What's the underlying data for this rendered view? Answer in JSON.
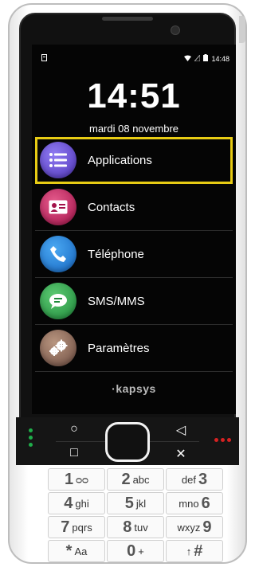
{
  "status_bar": {
    "time": "14:48"
  },
  "lock": {
    "time": "14:51",
    "date": "mardi 08 novembre"
  },
  "menu": [
    {
      "label": "Applications",
      "icon": "apps-list-icon",
      "color": "#6a4fd6",
      "selected": true
    },
    {
      "label": "Contacts",
      "icon": "contact-card-icon",
      "color": "#c2185b",
      "selected": false
    },
    {
      "label": "Téléphone",
      "icon": "phone-icon",
      "color": "#1e88e5",
      "selected": false
    },
    {
      "label": "SMS/MMS",
      "icon": "message-icon",
      "color": "#2fa84f",
      "selected": false
    },
    {
      "label": "Paramètres",
      "icon": "gear-icon",
      "color": "#8d6e63",
      "selected": false
    }
  ],
  "brand": "·kapsys",
  "nav_keys": {
    "top_left": "○",
    "top_right": "◁",
    "bottom_left": "□",
    "bottom_right": "✕"
  },
  "keypad": [
    [
      {
        "num": "1",
        "letters": "ᴑᴑ"
      },
      {
        "num": "2",
        "letters": "abc"
      },
      {
        "num": "3",
        "letters": "def"
      }
    ],
    [
      {
        "num": "4",
        "letters": "ghi"
      },
      {
        "num": "5",
        "letters": "jkl"
      },
      {
        "num": "6",
        "letters": "mno"
      }
    ],
    [
      {
        "num": "7",
        "letters": "pqrs"
      },
      {
        "num": "8",
        "letters": "tuv"
      },
      {
        "num": "9",
        "letters": "wxyz"
      }
    ],
    [
      {
        "num": "*",
        "letters": "Aa"
      },
      {
        "num": "0",
        "letters": "+"
      },
      {
        "num": "#",
        "letters": "↑"
      }
    ]
  ],
  "colors": {
    "selection": "#e8cc14",
    "led_green": "#1fae4a",
    "led_red": "#d62222"
  }
}
